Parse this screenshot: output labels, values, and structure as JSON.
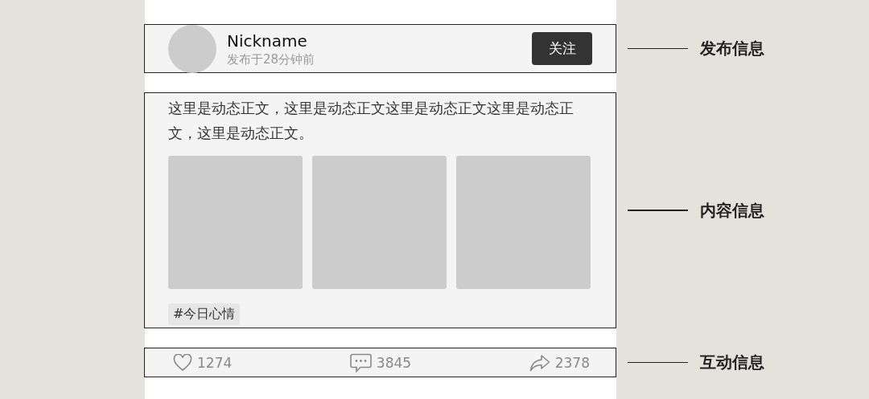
{
  "post": {
    "author": {
      "nickname": "Nickname",
      "time": "发布于28分钟前"
    },
    "follow_button": "关注",
    "body": "这里是动态正文，这里是动态正文这里是动态正文这里是动态正文，这里是动态正文。",
    "images": [
      {
        "kind": "placeholder"
      },
      {
        "kind": "placeholder"
      },
      {
        "kind": "placeholder"
      }
    ],
    "tag": "#今日心情",
    "stats": [
      {
        "kind": "like",
        "count": "1274"
      },
      {
        "kind": "comment",
        "count": "3845"
      },
      {
        "kind": "share",
        "count": "2378"
      }
    ]
  },
  "annotations": [
    {
      "label": "发布信息"
    },
    {
      "label": "内容信息"
    },
    {
      "label": "互动信息"
    }
  ]
}
